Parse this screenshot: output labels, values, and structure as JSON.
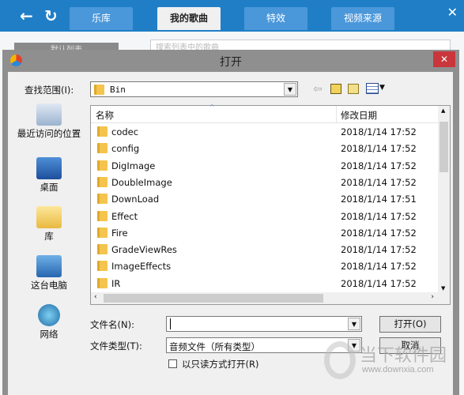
{
  "app": {
    "tabs": [
      "乐库",
      "我的歌曲",
      "特效",
      "视频来源"
    ],
    "active_tab": 1,
    "bg_button": "默认列表",
    "bg_search_placeholder": "搜索列表中的歌曲"
  },
  "dialog": {
    "title": "打开",
    "look_in_label": "查找范围(I):",
    "look_in_value": "Bin",
    "places": [
      "最近访问的位置",
      "桌面",
      "库",
      "这台电脑",
      "网络"
    ],
    "columns": [
      "名称",
      "修改日期"
    ],
    "files": [
      {
        "name": "codec",
        "date": "2018/1/14 17:52"
      },
      {
        "name": "config",
        "date": "2018/1/14 17:52"
      },
      {
        "name": "DigImage",
        "date": "2018/1/14 17:52"
      },
      {
        "name": "DoubleImage",
        "date": "2018/1/14 17:52"
      },
      {
        "name": "DownLoad",
        "date": "2018/1/14 17:51"
      },
      {
        "name": "Effect",
        "date": "2018/1/14 17:52"
      },
      {
        "name": "Fire",
        "date": "2018/1/14 17:52"
      },
      {
        "name": "GradeViewRes",
        "date": "2018/1/14 17:52"
      },
      {
        "name": "ImageEffects",
        "date": "2018/1/14 17:52"
      },
      {
        "name": "IR",
        "date": "2018/1/14 17:52"
      }
    ],
    "filename_label": "文件名(N):",
    "filename_value": "",
    "filetype_label": "文件类型(T):",
    "filetype_value": "音频文件（所有类型）",
    "readonly_label": "以只读方式打开(R)",
    "readonly_checked": false,
    "open_button": "打开(O)",
    "cancel_button": "取消"
  },
  "watermark": {
    "name": "当下软件园",
    "url": "www.downxia.com"
  }
}
